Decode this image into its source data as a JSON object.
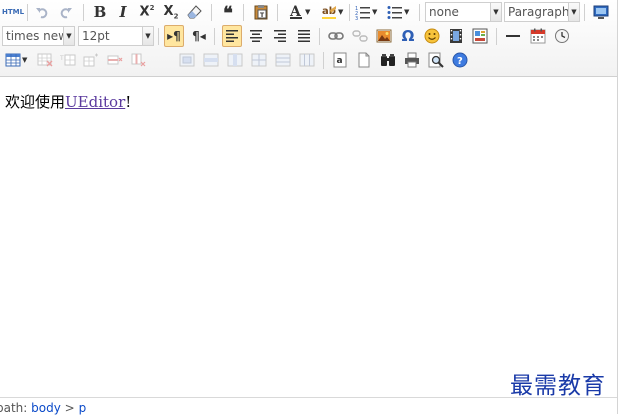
{
  "toolbar": {
    "source_label": "HTML",
    "font_family": "times new",
    "font_size": "12pt",
    "customstyle": "none",
    "paragraph": "Paragraph"
  },
  "content": {
    "welcome_prefix": "欢迎使用",
    "welcome_link": "UEditor",
    "welcome_suffix": "!"
  },
  "statusbar": {
    "label": "path:",
    "body": "body",
    "sep": ">",
    "p": "p"
  },
  "watermark": "最需教育",
  "colors": {
    "active_bg": "#ffe69f",
    "active_border": "#dcac6c",
    "link": "#5b3a9e",
    "path_link": "#0b4ac9",
    "watermark": "#1a3aa8"
  },
  "icons": {
    "row1": [
      "source-icon",
      "undo-icon",
      "redo-icon",
      "bold-icon",
      "italic-icon",
      "superscript-icon",
      "subscript-icon",
      "eraser-icon",
      "blockquote-icon",
      "paste-plain-icon",
      "forecolor-icon",
      "backcolor-icon",
      "ordered-list-icon",
      "unordered-list-icon",
      "fullscreen-icon"
    ],
    "row2": [
      "ltr-icon",
      "rtl-icon",
      "justify-left-icon",
      "justify-center-icon",
      "justify-right-icon",
      "justify-full-icon",
      "link-icon",
      "unlink-icon",
      "image-icon",
      "special-char-icon",
      "emotion-icon",
      "video-icon",
      "template-icon",
      "horizontal-rule-icon",
      "date-icon",
      "time-icon"
    ],
    "row3": [
      "insert-table-icon",
      "delete-table-icon",
      "insert-row-icon",
      "insert-col-icon",
      "delete-row-icon",
      "delete-col-icon",
      "merge-cells-icon",
      "merge-right-icon",
      "merge-down-icon",
      "split-cells-icon",
      "split-rows-icon",
      "split-cols-icon",
      "anchor-icon",
      "page-break-icon",
      "search-replace-icon",
      "print-icon",
      "preview-icon",
      "help-icon"
    ]
  }
}
